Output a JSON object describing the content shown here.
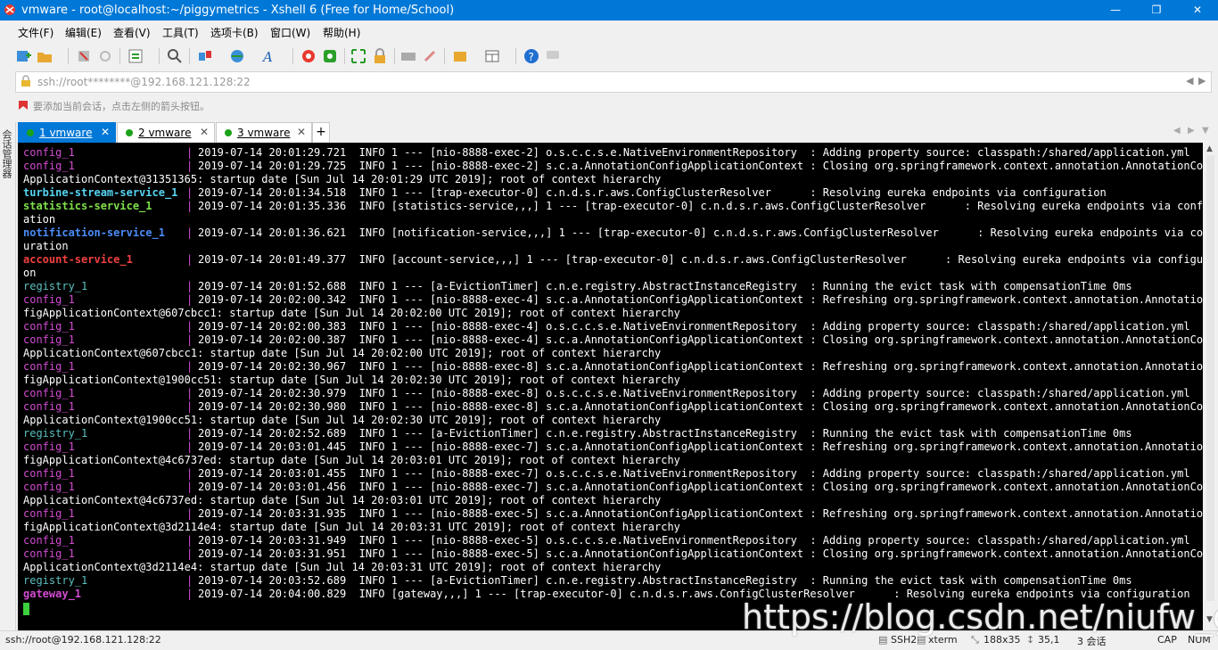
{
  "window": {
    "title": "vmware - root@localhost:~/piggymetrics - Xshell 6 (Free for Home/School)",
    "buttons": {
      "minimize": "—",
      "maximize": "❐",
      "close": "✕"
    }
  },
  "menu": [
    "文件(F)",
    "编辑(E)",
    "查看(V)",
    "工具(T)",
    "选项卡(B)",
    "窗口(W)",
    "帮助(H)"
  ],
  "address": {
    "value": "ssh://root********@192.168.121.128:22"
  },
  "hint": {
    "text": "要添加当前会话，点击左侧的箭头按钮。"
  },
  "side_panel": {
    "label": "会话管理器"
  },
  "tabs": [
    {
      "label": "1 vmware",
      "active": true
    },
    {
      "label": "2 vmware",
      "active": false
    },
    {
      "label": "3 vmware",
      "active": false
    }
  ],
  "terminal": {
    "lines": [
      {
        "service": "config_1",
        "cls": "c-config",
        "rest": "2019-07-14 20:01:29.721  INFO 1 --- [nio-8888-exec-2] o.s.c.c.s.e.NativeEnvironmentRepository  : Adding property source: classpath:/shared/application.yml"
      },
      {
        "service": "config_1",
        "cls": "c-config",
        "rest": "2019-07-14 20:01:29.725  INFO 1 --- [nio-8888-exec-2] s.c.a.AnnotationConfigApplicationContext : Closing org.springframework.context.annotation.AnnotationConfig"
      },
      {
        "cont": "ApplicationContext@31351365: startup date [Sun Jul 14 20:01:29 UTC 2019]; root of context hierarchy"
      },
      {
        "service": "turbine-stream-service_1",
        "cls": "c-turbine",
        "rest": "2019-07-14 20:01:34.518  INFO 1 --- [trap-executor-0] c.n.d.s.r.aws.ConfigClusterResolver      : Resolving eureka endpoints via configuration"
      },
      {
        "service": "statistics-service_1",
        "cls": "c-statistics",
        "rest": "2019-07-14 20:01:35.336  INFO [statistics-service,,,] 1 --- [trap-executor-0] c.n.d.s.r.aws.ConfigClusterResolver      : Resolving eureka endpoints via configur"
      },
      {
        "cont": "ation"
      },
      {
        "service": "notification-service_1",
        "cls": "c-notification",
        "rest": "2019-07-14 20:01:36.621  INFO [notification-service,,,] 1 --- [trap-executor-0] c.n.d.s.r.aws.ConfigClusterResolver      : Resolving eureka endpoints via config"
      },
      {
        "cont": "uration"
      },
      {
        "service": "account-service_1",
        "cls": "c-account",
        "rest": "2019-07-14 20:01:49.377  INFO [account-service,,,] 1 --- [trap-executor-0] c.n.d.s.r.aws.ConfigClusterResolver      : Resolving eureka endpoints via configurati"
      },
      {
        "cont": "on"
      },
      {
        "service": "registry_1",
        "cls": "c-registry",
        "rest": "2019-07-14 20:01:52.688  INFO 1 --- [a-EvictionTimer] c.n.e.registry.AbstractInstanceRegistry  : Running the evict task with compensationTime 0ms"
      },
      {
        "service": "config_1",
        "cls": "c-config",
        "rest": "2019-07-14 20:02:00.342  INFO 1 --- [nio-8888-exec-4] s.c.a.AnnotationConfigApplicationContext : Refreshing org.springframework.context.annotation.AnnotationCon"
      },
      {
        "cont": "figApplicationContext@607cbcc1: startup date [Sun Jul 14 20:02:00 UTC 2019]; root of context hierarchy"
      },
      {
        "service": "config_1",
        "cls": "c-config",
        "rest": "2019-07-14 20:02:00.383  INFO 1 --- [nio-8888-exec-4] o.s.c.c.s.e.NativeEnvironmentRepository  : Adding property source: classpath:/shared/application.yml"
      },
      {
        "service": "config_1",
        "cls": "c-config",
        "rest": "2019-07-14 20:02:00.387  INFO 1 --- [nio-8888-exec-4] s.c.a.AnnotationConfigApplicationContext : Closing org.springframework.context.annotation.AnnotationConfig"
      },
      {
        "cont": "ApplicationContext@607cbcc1: startup date [Sun Jul 14 20:02:00 UTC 2019]; root of context hierarchy"
      },
      {
        "service": "config_1",
        "cls": "c-config",
        "rest": "2019-07-14 20:02:30.967  INFO 1 --- [nio-8888-exec-8] s.c.a.AnnotationConfigApplicationContext : Refreshing org.springframework.context.annotation.AnnotationCon"
      },
      {
        "cont": "figApplicationContext@1900cc51: startup date [Sun Jul 14 20:02:30 UTC 2019]; root of context hierarchy"
      },
      {
        "service": "config_1",
        "cls": "c-config",
        "rest": "2019-07-14 20:02:30.979  INFO 1 --- [nio-8888-exec-8] o.s.c.c.s.e.NativeEnvironmentRepository  : Adding property source: classpath:/shared/application.yml"
      },
      {
        "service": "config_1",
        "cls": "c-config",
        "rest": "2019-07-14 20:02:30.980  INFO 1 --- [nio-8888-exec-8] s.c.a.AnnotationConfigApplicationContext : Closing org.springframework.context.annotation.AnnotationConfig"
      },
      {
        "cont": "ApplicationContext@1900cc51: startup date [Sun Jul 14 20:02:30 UTC 2019]; root of context hierarchy"
      },
      {
        "service": "registry_1",
        "cls": "c-registry",
        "rest": "2019-07-14 20:02:52.689  INFO 1 --- [a-EvictionTimer] c.n.e.registry.AbstractInstanceRegistry  : Running the evict task with compensationTime 0ms"
      },
      {
        "service": "config_1",
        "cls": "c-config",
        "rest": "2019-07-14 20:03:01.445  INFO 1 --- [nio-8888-exec-7] s.c.a.AnnotationConfigApplicationContext : Refreshing org.springframework.context.annotation.AnnotationCon"
      },
      {
        "cont": "figApplicationContext@4c6737ed: startup date [Sun Jul 14 20:03:01 UTC 2019]; root of context hierarchy"
      },
      {
        "service": "config_1",
        "cls": "c-config",
        "rest": "2019-07-14 20:03:01.455  INFO 1 --- [nio-8888-exec-7] o.s.c.c.s.e.NativeEnvironmentRepository  : Adding property source: classpath:/shared/application.yml"
      },
      {
        "service": "config_1",
        "cls": "c-config",
        "rest": "2019-07-14 20:03:01.456  INFO 1 --- [nio-8888-exec-7] s.c.a.AnnotationConfigApplicationContext : Closing org.springframework.context.annotation.AnnotationConfig"
      },
      {
        "cont": "ApplicationContext@4c6737ed: startup date [Sun Jul 14 20:03:01 UTC 2019]; root of context hierarchy"
      },
      {
        "service": "config_1",
        "cls": "c-config",
        "rest": "2019-07-14 20:03:31.935  INFO 1 --- [nio-8888-exec-5] s.c.a.AnnotationConfigApplicationContext : Refreshing org.springframework.context.annotation.AnnotationCon"
      },
      {
        "cont": "figApplicationContext@3d2114e4: startup date [Sun Jul 14 20:03:31 UTC 2019]; root of context hierarchy"
      },
      {
        "service": "config_1",
        "cls": "c-config",
        "rest": "2019-07-14 20:03:31.949  INFO 1 --- [nio-8888-exec-5] o.s.c.c.s.e.NativeEnvironmentRepository  : Adding property source: classpath:/shared/application.yml"
      },
      {
        "service": "config_1",
        "cls": "c-config",
        "rest": "2019-07-14 20:03:31.951  INFO 1 --- [nio-8888-exec-5] s.c.a.AnnotationConfigApplicationContext : Closing org.springframework.context.annotation.AnnotationConfig"
      },
      {
        "cont": "ApplicationContext@3d2114e4: startup date [Sun Jul 14 20:03:31 UTC 2019]; root of context hierarchy"
      },
      {
        "service": "registry_1",
        "cls": "c-registry",
        "rest": "2019-07-14 20:03:52.689  INFO 1 --- [a-EvictionTimer] c.n.e.registry.AbstractInstanceRegistry  : Running the evict task with compensationTime 0ms"
      },
      {
        "service": "gateway_1",
        "cls": "c-gateway",
        "rest": "2019-07-14 20:04:00.829  INFO [gateway,,,] 1 --- [trap-executor-0] c.n.d.s.r.aws.ConfigClusterResolver      : Resolving eureka endpoints via configuration"
      }
    ]
  },
  "statusbar": {
    "connection": "ssh://root@192.168.121.128:22",
    "protocol": "SSH2",
    "terminal_type": "xterm",
    "size": "188x35",
    "cursor": "35,1",
    "sessions": "3 会话",
    "caps": "CAP",
    "num": "NUM"
  },
  "watermark": "https://blog.csdn.net/niufw_gb",
  "colors": {
    "accent": "#0078d7",
    "terminal_bg": "#000000",
    "cursor": "#3ed03e"
  }
}
